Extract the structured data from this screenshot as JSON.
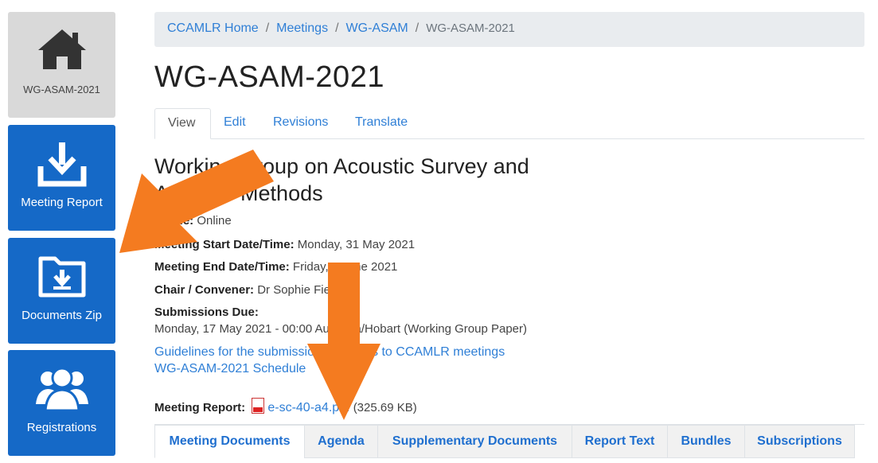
{
  "sidebar": {
    "home_label": "WG-ASAM-2021",
    "report_label": "Meeting Report",
    "zip_label": "Documents Zip",
    "registrations_label": "Registrations"
  },
  "breadcrumb": {
    "items": [
      "CCAMLR Home",
      "Meetings",
      "WG-ASAM"
    ],
    "current": "WG-ASAM-2021"
  },
  "page_title": "WG-ASAM-2021",
  "tabs": [
    "View",
    "Edit",
    "Revisions",
    "Translate"
  ],
  "meeting": {
    "name": "Working Group on Acoustic Survey and Analysis Methods",
    "venue_label": "Venue:",
    "venue": "Online",
    "start_label": "Meeting Start Date/Time:",
    "start": "Monday, 31 May 2021",
    "end_label": "Meeting End Date/Time:",
    "end": "Friday, 4 June 2021",
    "chair_label": "Chair / Convener:",
    "chair": "Dr Sophie Fielding",
    "submissions_label": "Submissions Due:",
    "submissions": "Monday, 17 May 2021 - 00:00 Australia/Hobart (Working Group Paper)",
    "guidelines_link": "Guidelines for the submission of papers to CCAMLR meetings",
    "schedule_link": "WG-ASAM-2021 Schedule",
    "report_label": "Meeting Report:",
    "report_file": "e-sc-40-a4.pdf",
    "report_size": "(325.69 KB)"
  },
  "bottom_tabs": [
    "Meeting Documents",
    "Agenda",
    "Supplementary Documents",
    "Report Text",
    "Bundles",
    "Subscriptions"
  ],
  "colors": {
    "accent": "#1569c7",
    "link": "#2f7fd6",
    "arrow": "#f47b20"
  },
  "icons": [
    "home-icon",
    "download-icon",
    "folder-download-icon",
    "users-icon",
    "pdf-icon"
  ]
}
